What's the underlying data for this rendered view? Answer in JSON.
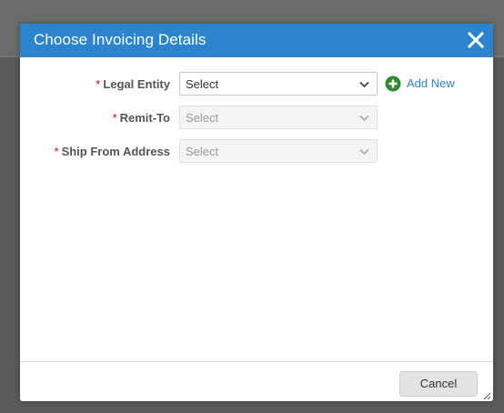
{
  "dialog": {
    "title": "Choose Invoicing Details",
    "close_icon": "close-icon"
  },
  "fields": [
    {
      "label": "Legal Entity",
      "required": "*",
      "value": "Select",
      "disabled": false
    },
    {
      "label": "Remit-To",
      "required": "*",
      "value": "Select",
      "disabled": true
    },
    {
      "label": "Ship From Address",
      "required": "*",
      "value": "Select",
      "disabled": true
    }
  ],
  "add_new": {
    "label": "Add New",
    "icon": "plus-circle-icon",
    "color": "#2e8b2e"
  },
  "footer": {
    "cancel_label": "Cancel"
  },
  "colors": {
    "header": "#2b84cc",
    "required": "#d0021b",
    "link": "#2b84cc"
  }
}
